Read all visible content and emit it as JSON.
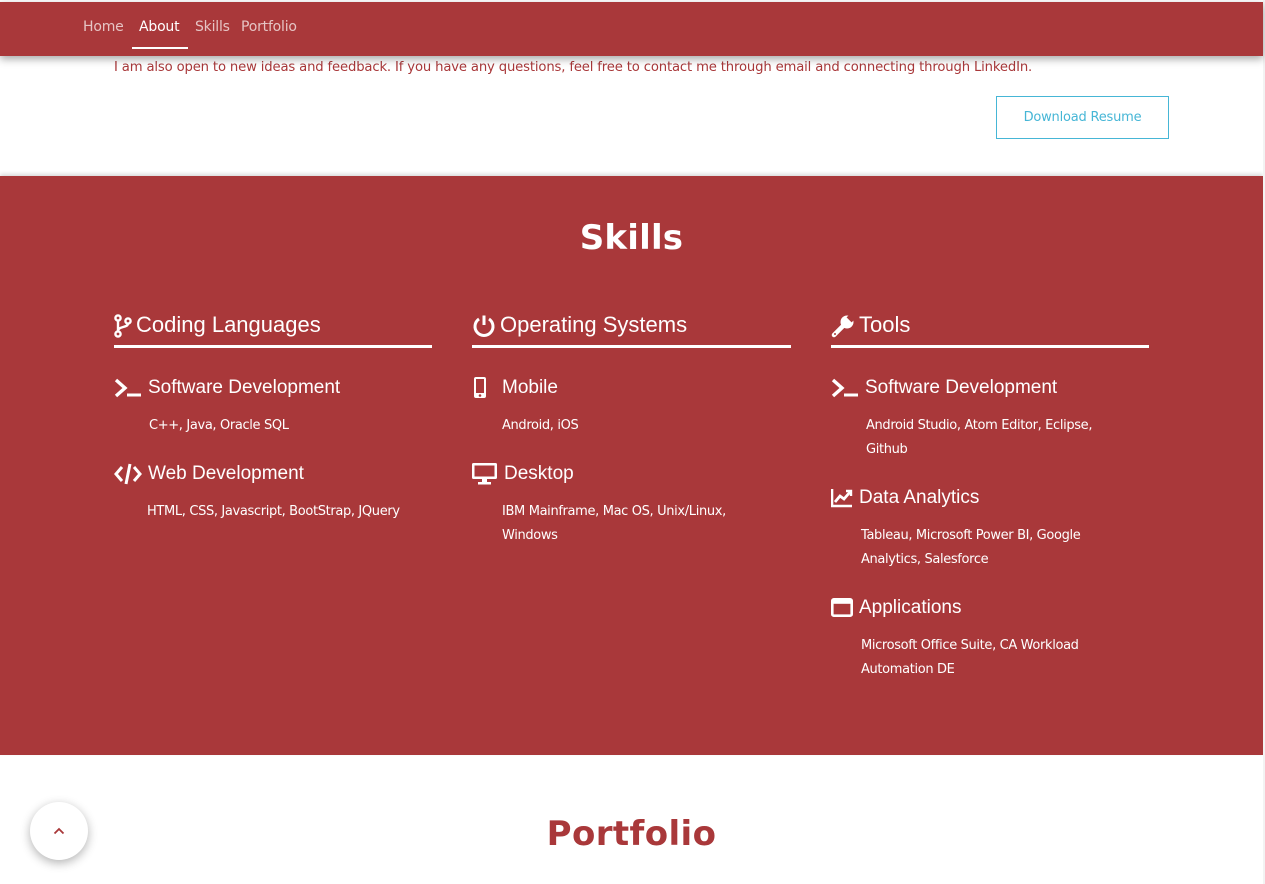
{
  "nav": {
    "items": [
      {
        "label": "Home"
      },
      {
        "label": "About"
      },
      {
        "label": "Skills"
      },
      {
        "label": "Portfolio"
      }
    ],
    "active": "About"
  },
  "about": {
    "text": "I am also open to new ideas and feedback. If you have any questions, feel free to contact me through email and connecting through LinkedIn.",
    "resume_button": "Download Resume"
  },
  "skills": {
    "title": "Skills",
    "columns": [
      {
        "heading": "Coding Languages",
        "icon": "code-branch-icon",
        "items": [
          {
            "title": "Software Development",
            "icon": "terminal-icon",
            "text": "C++, Java, Oracle SQL"
          },
          {
            "title": "Web Development",
            "icon": "code-icon",
            "text": "HTML, CSS, Javascript, BootStrap, JQuery"
          }
        ]
      },
      {
        "heading": "Operating Systems",
        "icon": "power-icon",
        "items": [
          {
            "title": "Mobile",
            "icon": "mobile-icon",
            "text": "Android, iOS"
          },
          {
            "title": "Desktop",
            "icon": "desktop-icon",
            "text": "IBM Mainframe, Mac OS, Unix/Linux, Windows"
          }
        ]
      },
      {
        "heading": "Tools",
        "icon": "wrench-icon",
        "items": [
          {
            "title": "Software Development",
            "icon": "terminal-icon",
            "text": "Android Studio, Atom Editor, Eclipse, Github"
          },
          {
            "title": "Data Analytics",
            "icon": "chart-line-icon",
            "text": "Tableau, Microsoft Power BI, Google Analytics, Salesforce"
          },
          {
            "title": "Applications",
            "icon": "window-icon",
            "text": "Microsoft Office Suite, CA Workload Automation DE"
          }
        ]
      }
    ]
  },
  "portfolio": {
    "title": "Portfolio"
  },
  "scroll_top": {
    "icon": "chevron-up-icon",
    "glyph": "^"
  },
  "colors": {
    "brand": "#a9383a",
    "accent": "#46b6d6",
    "text_light": "#ffffff"
  }
}
